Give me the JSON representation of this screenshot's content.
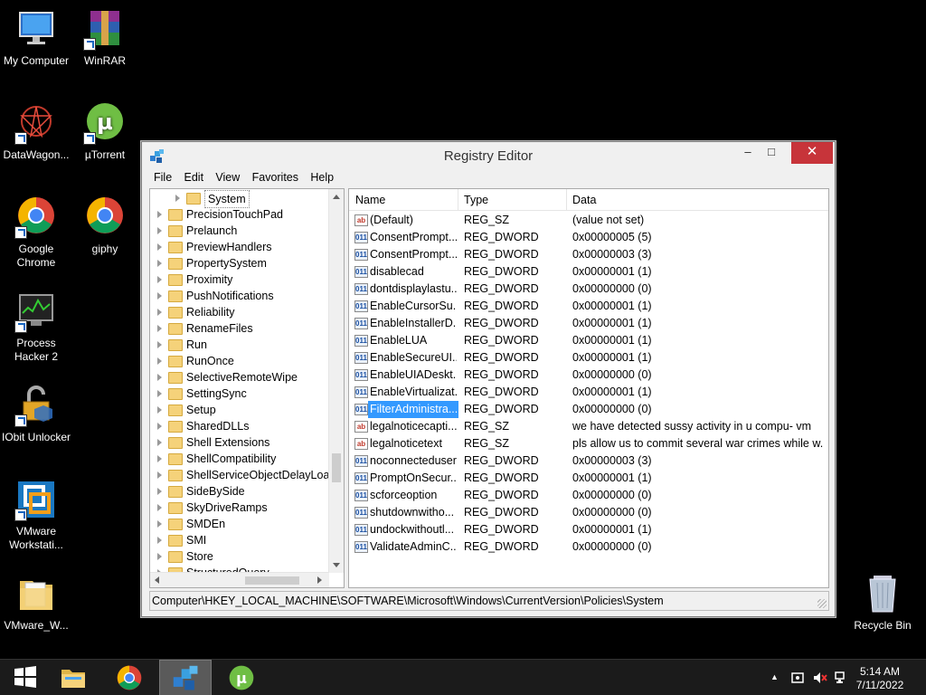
{
  "desktop": {
    "icons": [
      {
        "label": "My Computer"
      },
      {
        "label": "WinRAR"
      },
      {
        "label": "DataWagon..."
      },
      {
        "label": "µTorrent"
      },
      {
        "label": "Google Chrome"
      },
      {
        "label": "giphy"
      },
      {
        "label": "Process Hacker 2"
      },
      {
        "label": "IObit Unlocker"
      },
      {
        "label": "VMware Workstati..."
      },
      {
        "label": "VMware_W..."
      },
      {
        "label": "Recycle Bin"
      }
    ]
  },
  "window": {
    "title": "Registry Editor",
    "minimize": "–",
    "maximize": "□",
    "close": "✕",
    "menu": [
      "File",
      "Edit",
      "View",
      "Favorites",
      "Help"
    ]
  },
  "tree": {
    "items": [
      "System",
      "PrecisionTouchPad",
      "Prelaunch",
      "PreviewHandlers",
      "PropertySystem",
      "Proximity",
      "PushNotifications",
      "Reliability",
      "RenameFiles",
      "Run",
      "RunOnce",
      "SelectiveRemoteWipe",
      "SettingSync",
      "Setup",
      "SharedDLLs",
      "Shell Extensions",
      "ShellCompatibility",
      "ShellServiceObjectDelayLoad",
      "SideBySide",
      "SkyDriveRamps",
      "SMDEn",
      "SMI",
      "Store",
      "StructuredQuery"
    ]
  },
  "list": {
    "columns": {
      "name": "Name",
      "type": "Type",
      "data": "Data"
    },
    "rows": [
      {
        "icon": "ab",
        "name": "(Default)",
        "type": "REG_SZ",
        "data": "(value not set)"
      },
      {
        "icon": "dw",
        "name": "ConsentPrompt...",
        "type": "REG_DWORD",
        "data": "0x00000005 (5)"
      },
      {
        "icon": "dw",
        "name": "ConsentPrompt...",
        "type": "REG_DWORD",
        "data": "0x00000003 (3)"
      },
      {
        "icon": "dw",
        "name": "disablecad",
        "type": "REG_DWORD",
        "data": "0x00000001 (1)"
      },
      {
        "icon": "dw",
        "name": "dontdisplaylastu...",
        "type": "REG_DWORD",
        "data": "0x00000000 (0)"
      },
      {
        "icon": "dw",
        "name": "EnableCursorSu...",
        "type": "REG_DWORD",
        "data": "0x00000001 (1)"
      },
      {
        "icon": "dw",
        "name": "EnableInstallerD...",
        "type": "REG_DWORD",
        "data": "0x00000001 (1)"
      },
      {
        "icon": "dw",
        "name": "EnableLUA",
        "type": "REG_DWORD",
        "data": "0x00000001 (1)"
      },
      {
        "icon": "dw",
        "name": "EnableSecureUI...",
        "type": "REG_DWORD",
        "data": "0x00000001 (1)"
      },
      {
        "icon": "dw",
        "name": "EnableUIADeskt...",
        "type": "REG_DWORD",
        "data": "0x00000000 (0)"
      },
      {
        "icon": "dw",
        "name": "EnableVirtualizat...",
        "type": "REG_DWORD",
        "data": "0x00000001 (1)"
      },
      {
        "icon": "dw",
        "name": "FilterAdministra...",
        "type": "REG_DWORD",
        "data": "0x00000000 (0)",
        "selected": true
      },
      {
        "icon": "ab",
        "name": "legalnoticecapti...",
        "type": "REG_SZ",
        "data": "we have detected sussy activity in u compu- vm"
      },
      {
        "icon": "ab",
        "name": "legalnoticetext",
        "type": "REG_SZ",
        "data": "pls allow us to commit several war crimes while w..."
      },
      {
        "icon": "dw",
        "name": "noconnecteduser",
        "type": "REG_DWORD",
        "data": "0x00000003 (3)"
      },
      {
        "icon": "dw",
        "name": "PromptOnSecur...",
        "type": "REG_DWORD",
        "data": "0x00000001 (1)"
      },
      {
        "icon": "dw",
        "name": "scforceoption",
        "type": "REG_DWORD",
        "data": "0x00000000 (0)"
      },
      {
        "icon": "dw",
        "name": "shutdownwitho...",
        "type": "REG_DWORD",
        "data": "0x00000000 (0)"
      },
      {
        "icon": "dw",
        "name": "undockwithoutl...",
        "type": "REG_DWORD",
        "data": "0x00000001 (1)"
      },
      {
        "icon": "dw",
        "name": "ValidateAdminC...",
        "type": "REG_DWORD",
        "data": "0x00000000 (0)"
      }
    ]
  },
  "statusbar": {
    "path": "Computer\\HKEY_LOCAL_MACHINE\\SOFTWARE\\Microsoft\\Windows\\CurrentVersion\\Policies\\System"
  },
  "taskbar": {
    "items": [
      "start-button",
      "file-explorer",
      "google-chrome",
      "registry-editor",
      "utorrent"
    ],
    "clock_time": "5:14 AM",
    "clock_date": "7/11/2022"
  },
  "colors": {
    "selection": "#3399ff",
    "close_button": "#c7343a"
  }
}
